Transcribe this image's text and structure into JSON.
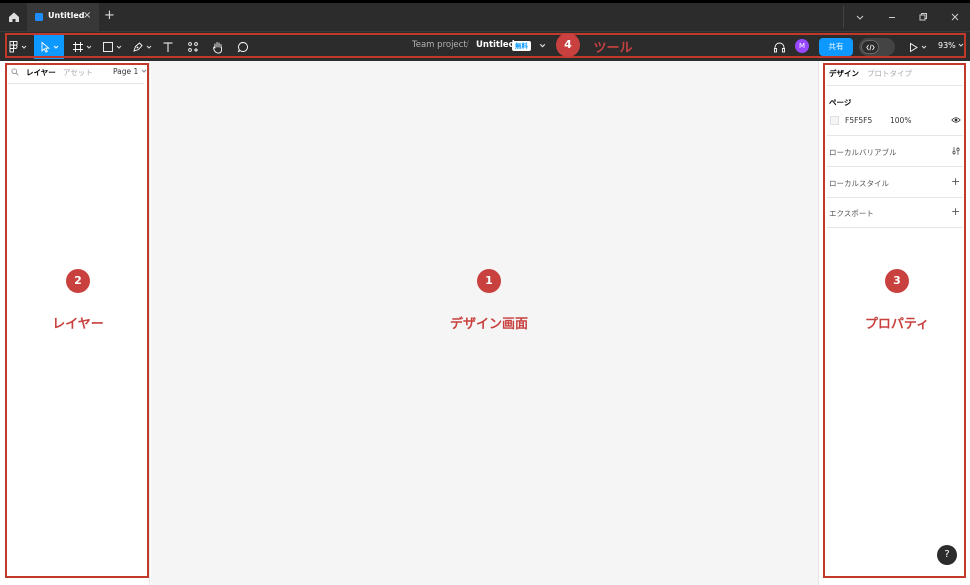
{
  "titlebar": {
    "tab_title": "Untitled",
    "tab_close": "×",
    "tab_add": "+"
  },
  "toolbar": {
    "project": "Team project",
    "separator": "/",
    "file_name": "Untitled",
    "plan_badge": "無料",
    "avatar_initial": "M",
    "share_label": "共有",
    "zoom": "93%"
  },
  "left_panel": {
    "tab_layers": "レイヤー",
    "tab_assets": "アセット",
    "page_selector": "Page 1"
  },
  "right_panel": {
    "tab_design": "デザイン",
    "tab_prototype": "プロトタイプ",
    "page_heading": "ページ",
    "bg_hex": "F5F5F5",
    "bg_opacity": "100%",
    "local_variables": "ローカルバリアブル",
    "local_styles": "ローカルスタイル",
    "export": "エクスポート",
    "add_icon": "+",
    "help": "?"
  },
  "annotations": {
    "canvas": {
      "num": "1",
      "label": "デザイン画面"
    },
    "layers": {
      "num": "2",
      "label": "レイヤー"
    },
    "properties": {
      "num": "3",
      "label": "プロパティ"
    },
    "tools": {
      "num": "4",
      "label": "ツール"
    }
  },
  "colors": {
    "accent": "#0d99ff",
    "annotation": "#c8413f",
    "canvas_bg": "#f5f5f5",
    "chrome": "#2c2c2c"
  }
}
